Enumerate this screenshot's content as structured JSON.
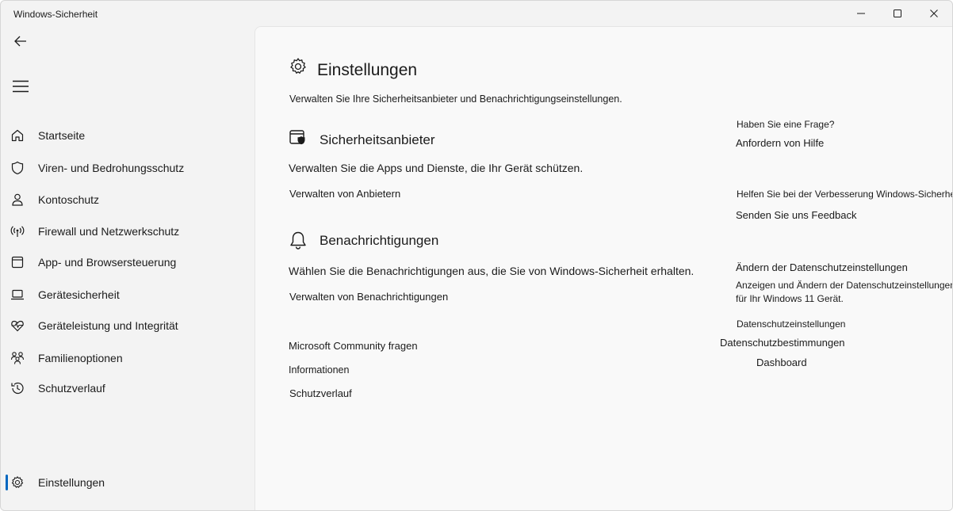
{
  "window": {
    "title": "Windows-Sicherheit"
  },
  "sidebar": {
    "items": [
      {
        "label": "Startseite",
        "icon": "home-icon"
      },
      {
        "label": "Viren- und Bedrohungsschutz",
        "icon": "shield-icon"
      },
      {
        "label": "Kontoschutz",
        "icon": "person-icon"
      },
      {
        "label": "Firewall und Netzwerkschutz",
        "icon": "wireless-icon"
      },
      {
        "label": "App- und Browsersteuerung",
        "icon": "app-window-icon"
      },
      {
        "label": "Gerätesicherheit",
        "icon": "laptop-icon"
      },
      {
        "label": "Geräteleistung und Integrität",
        "icon": "heart-pulse-icon"
      },
      {
        "label": "Familienoptionen",
        "icon": "family-icon"
      },
      {
        "label": "Schutzverlauf",
        "icon": "history-icon"
      }
    ],
    "settings": {
      "label": "Einstellungen",
      "icon": "gear-icon",
      "active": true
    }
  },
  "main": {
    "title": "Einstellungen",
    "subtitle": "Verwalten Sie Ihre Sicherheitsanbieter und Benachrichtigungseinstellungen.",
    "providers": {
      "title": "Sicherheitsanbieter",
      "description": "Verwalten Sie die Apps und Dienste, die Ihr Gerät schützen.",
      "link": "Verwalten von Anbietern"
    },
    "notifications": {
      "title": "Benachrichtigungen",
      "description": "Wählen Sie die Benachrichtigungen aus, die Sie von Windows-Sicherheit erhalten.",
      "link": "Verwalten von Benachrichtigungen"
    },
    "links": {
      "community": "Microsoft Community fragen",
      "info": "Informationen",
      "history": "Schutzverlauf"
    }
  },
  "aside": {
    "question_heading": "Haben Sie eine Frage?",
    "help_link": "Anfordern von Hilfe",
    "improve_heading": "Helfen Sie bei der Verbesserung Windows-Sicherheit",
    "feedback_link": "Senden Sie uns Feedback",
    "privacy_heading": "Ändern der Datenschutzeinstellungen",
    "privacy_desc_line1": "Anzeigen und Ändern der Datenschutzeinstellungen",
    "privacy_desc_line2": "für Ihr Windows 11 Gerät.",
    "privacy_settings_link": "Datenschutzeinstellungen",
    "privacy_statement_link": "Datenschutzbestimmungen",
    "dashboard_link": "Dashboard"
  },
  "colors": {
    "accent": "#0067c0",
    "sidebar_bg": "#f3f3f3",
    "content_bg": "#f9f9f9"
  }
}
